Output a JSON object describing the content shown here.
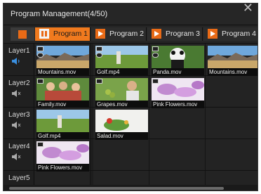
{
  "window": {
    "title": "Program Management(4/50)",
    "close_glyph": "✕"
  },
  "tabs": [
    {
      "label": "Program 1",
      "icon": "pause-icon",
      "active": true
    },
    {
      "label": "Program 2",
      "icon": "play-icon",
      "active": false
    },
    {
      "label": "Program 3",
      "icon": "play-icon",
      "active": false
    },
    {
      "label": "Program 4",
      "icon": "play-icon",
      "active": false
    }
  ],
  "layers": [
    {
      "label": "Layer1",
      "audio": "speaker-on-icon",
      "clips": [
        "Mountains.mov",
        "Golf.mp4",
        "Panda.mov",
        "Mountains.mov"
      ]
    },
    {
      "label": "Layer2",
      "audio": "speaker-muted-icon",
      "clips": [
        "Family.mov",
        "Grapes.mov",
        "Pink Flowers.mov"
      ]
    },
    {
      "label": "Layer3",
      "audio": "speaker-muted-icon",
      "clips": [
        "Golf.mp4",
        "Salad.mov"
      ]
    },
    {
      "label": "Layer4",
      "audio": "speaker-muted-icon",
      "clips": [
        "Pink Flowers.mov"
      ]
    },
    {
      "label": "Layer5",
      "audio": "speaker-muted-icon",
      "clips": []
    }
  ],
  "colors": {
    "accent": "#f07a1e",
    "panel": "#1d1d1d",
    "speaker_on": "#3a8fe0"
  }
}
